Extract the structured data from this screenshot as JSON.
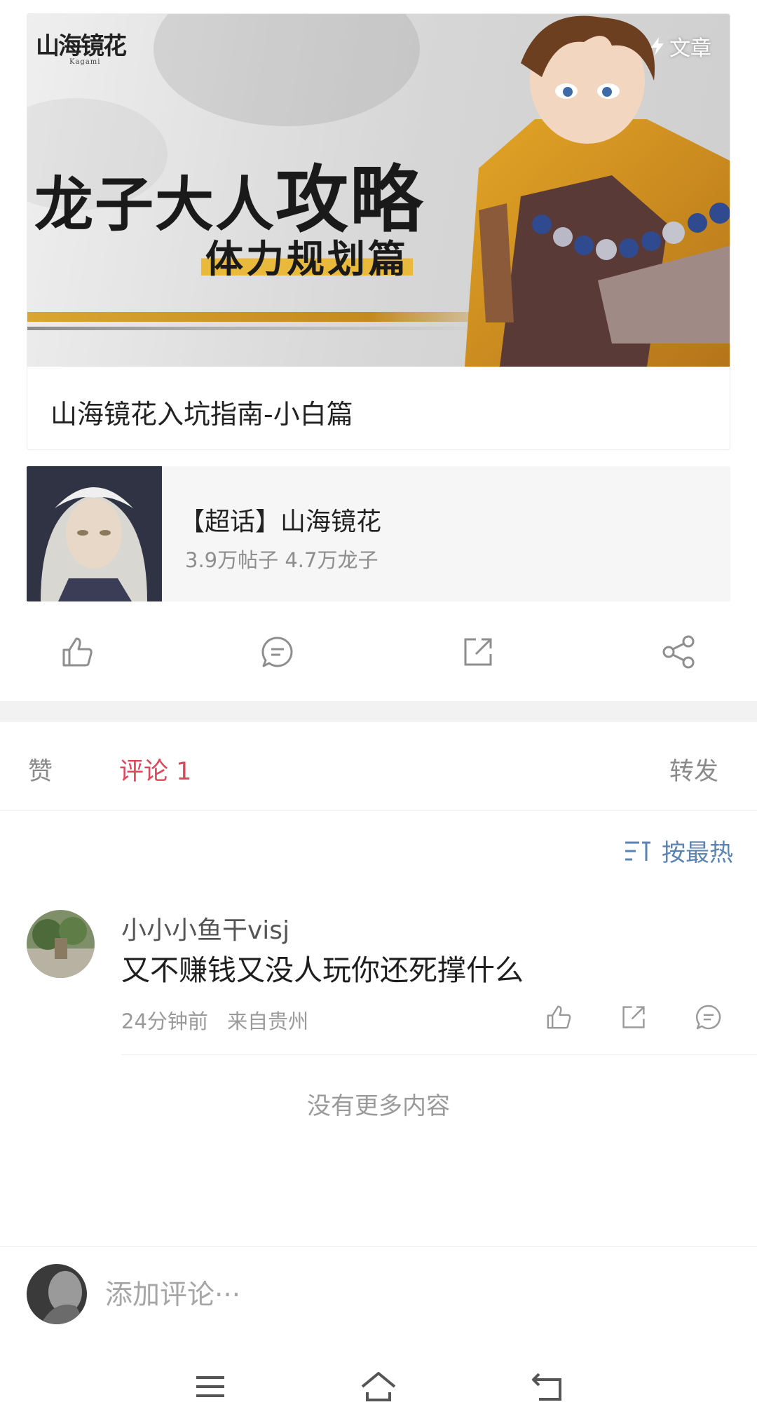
{
  "article": {
    "banner_logo": "山海镜花",
    "banner_logo_sub": "Kagami",
    "banner_tag": "文章",
    "banner_headline_a": "龙子大人",
    "banner_headline_b": "攻略",
    "banner_subline": "体力规划篇",
    "title": "山海镜花入坑指南-小白篇"
  },
  "topic": {
    "title": "【超话】山海镜花",
    "stats": "3.9万帖子 4.7万龙子"
  },
  "actions": {
    "like_icon": "thumbs-up-icon",
    "comment_icon": "comment-icon",
    "repost_icon": "repost-icon",
    "share_icon": "share-icon"
  },
  "tabs": [
    {
      "label": "赞"
    },
    {
      "label": "评论 1"
    },
    {
      "label": "转发"
    }
  ],
  "sort": {
    "label": "按最热",
    "icon": "sort-icon"
  },
  "comments": [
    {
      "user": "小小小鱼干visj",
      "text": "又不赚钱又没人玩你还死撑什么",
      "time": "24分钟前",
      "location": "来自贵州"
    }
  ],
  "no_more": "没有更多内容",
  "input": {
    "placeholder": "添加评论···"
  },
  "colors": {
    "accent_red": "#e0455a",
    "link_blue": "#5b84b3",
    "banner_gold": "#e8b93a"
  }
}
